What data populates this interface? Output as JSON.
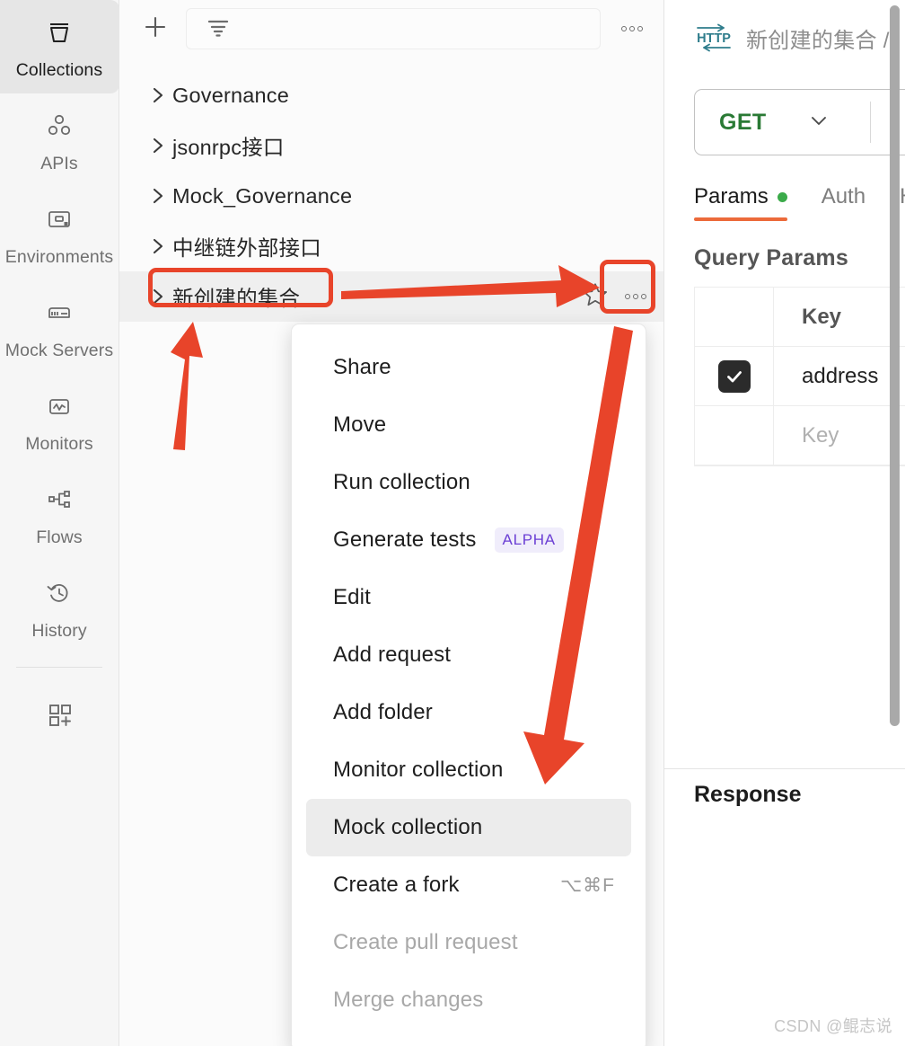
{
  "app": {
    "watermark": "CSDN @鲲志说"
  },
  "rail": {
    "items": [
      {
        "label": "Collections",
        "icon": "collections-icon",
        "active": true
      },
      {
        "label": "APIs",
        "icon": "apis-icon",
        "active": false
      },
      {
        "label": "Environments",
        "icon": "environments-icon",
        "active": false
      },
      {
        "label": "Mock Servers",
        "icon": "mock-servers-icon",
        "active": false
      },
      {
        "label": "Monitors",
        "icon": "monitors-icon",
        "active": false
      },
      {
        "label": "Flows",
        "icon": "flows-icon",
        "active": false
      },
      {
        "label": "History",
        "icon": "history-icon",
        "active": false
      }
    ],
    "bottom_icon": "add-panel-icon"
  },
  "panel": {
    "new_button_icon": "plus-icon",
    "filter_icon": "filter-icon",
    "filter_placeholder": "",
    "more_icon": "more-horizontal-icon",
    "collections": [
      {
        "name": "Governance",
        "selected": false
      },
      {
        "name": "jsonrpc接口",
        "selected": false
      },
      {
        "name": "Mock_Governance",
        "selected": false
      },
      {
        "name": "中继链外部接口",
        "selected": false
      },
      {
        "name": "新创建的集合",
        "selected": true
      }
    ],
    "row_star_icon": "star-icon",
    "row_more_icon": "more-horizontal-icon"
  },
  "context_menu": {
    "items": [
      {
        "label": "Share",
        "badge": "",
        "shortcut": "",
        "disabled": false,
        "hover": false
      },
      {
        "label": "Move",
        "badge": "",
        "shortcut": "",
        "disabled": false,
        "hover": false
      },
      {
        "label": "Run collection",
        "badge": "",
        "shortcut": "",
        "disabled": false,
        "hover": false
      },
      {
        "label": "Generate tests",
        "badge": "ALPHA",
        "shortcut": "",
        "disabled": false,
        "hover": false
      },
      {
        "label": "Edit",
        "badge": "",
        "shortcut": "",
        "disabled": false,
        "hover": false
      },
      {
        "label": "Add request",
        "badge": "",
        "shortcut": "",
        "disabled": false,
        "hover": false
      },
      {
        "label": "Add folder",
        "badge": "",
        "shortcut": "",
        "disabled": false,
        "hover": false
      },
      {
        "label": "Monitor collection",
        "badge": "",
        "shortcut": "",
        "disabled": false,
        "hover": false
      },
      {
        "label": "Mock collection",
        "badge": "",
        "shortcut": "",
        "disabled": false,
        "hover": true
      },
      {
        "label": "Create a fork",
        "badge": "",
        "shortcut": "⌥⌘F",
        "disabled": false,
        "hover": false
      },
      {
        "label": "Create pull request",
        "badge": "",
        "shortcut": "",
        "disabled": true,
        "hover": false
      },
      {
        "label": "Merge changes",
        "badge": "",
        "shortcut": "",
        "disabled": true,
        "hover": false
      }
    ]
  },
  "request": {
    "protocol_icon": "http-icon",
    "breadcrumb": "新创建的集合 /",
    "method": "GET",
    "method_chevron_icon": "chevron-down-icon",
    "tabs": [
      {
        "label": "Params",
        "dot": true,
        "active": true
      },
      {
        "label": "Auth",
        "dot": false,
        "active": false
      },
      {
        "label": "H",
        "dot": false,
        "active": false
      }
    ],
    "query_params": {
      "title": "Query Params",
      "columns": [
        "",
        "Key"
      ],
      "rows": [
        {
          "checked": true,
          "key": "address",
          "placeholder": false
        },
        {
          "checked": false,
          "key": "Key",
          "placeholder": true
        }
      ]
    },
    "response_title": "Response"
  },
  "annotations": {
    "highlight_color": "#e8442a",
    "boxes": [
      "collection-name-box",
      "collection-more-button-box"
    ],
    "arrows": [
      "arrow-to-more-button",
      "arrow-up-to-collection",
      "arrow-down-to-mock-collection"
    ]
  }
}
